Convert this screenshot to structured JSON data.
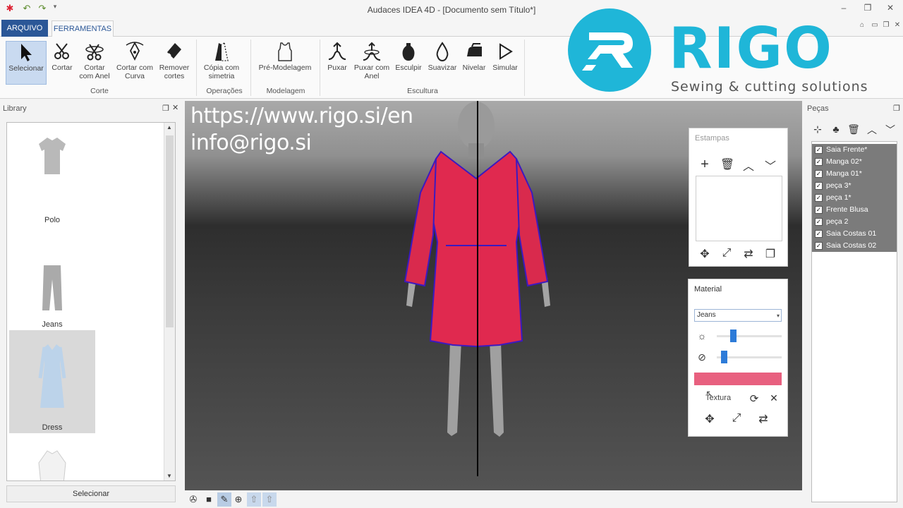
{
  "window": {
    "title": "Audaces IDEA 4D - [Documento sem Título*]"
  },
  "tabs": {
    "file": "ARQUIVO",
    "tools": "FERRAMENTAS"
  },
  "ribbon": {
    "buttons": {
      "select": "Selecionar",
      "cut": "Cortar",
      "cut_ring_1": "Cortar",
      "cut_ring_2": "com Anel",
      "cut_curve_1": "Cortar com",
      "cut_curve_2": "Curva",
      "remove_cuts_1": "Remover",
      "remove_cuts_2": "cortes",
      "symmetry_copy_1": "Cópia com",
      "symmetry_copy_2": "simetria",
      "pre_modeling": "Pré-Modelagem",
      "pull": "Puxar",
      "pull_ring_1": "Puxar com",
      "pull_ring_2": "Anel",
      "sculpt": "Esculpir",
      "smooth": "Suavizar",
      "level": "Nivelar",
      "simulate": "Simular"
    },
    "groups": {
      "cut": "Corte",
      "operations": "Operações",
      "modeling": "Modelagem",
      "sculpture": "Escultura"
    }
  },
  "library": {
    "title": "Library",
    "items": [
      "Polo",
      "Jeans",
      "Dress"
    ],
    "selected": "Dress",
    "select_button": "Selecionar"
  },
  "overlay": {
    "url": "https://www.rigo.si/en",
    "email": "info@rigo.si"
  },
  "logo": {
    "name": "RIGO",
    "tagline": "Sewing & cutting solutions",
    "color": "#1fb6d8"
  },
  "estampas": {
    "title": "Estampas"
  },
  "material": {
    "title": "Material",
    "selected": "Jeans",
    "brightness": 0.3,
    "opacity": 0.22,
    "swatch_color": "#e8607f",
    "texture_label": "Textura"
  },
  "pecas": {
    "title": "Peças",
    "items": [
      "Saia Frente*",
      "Manga 02*",
      "Manga 01*",
      "peça 3*",
      "peça 1*",
      "Frente Blusa",
      "peça 2",
      "Saia Costas 01",
      "Saia Costas 02"
    ]
  },
  "garment_color": "#e0294f"
}
